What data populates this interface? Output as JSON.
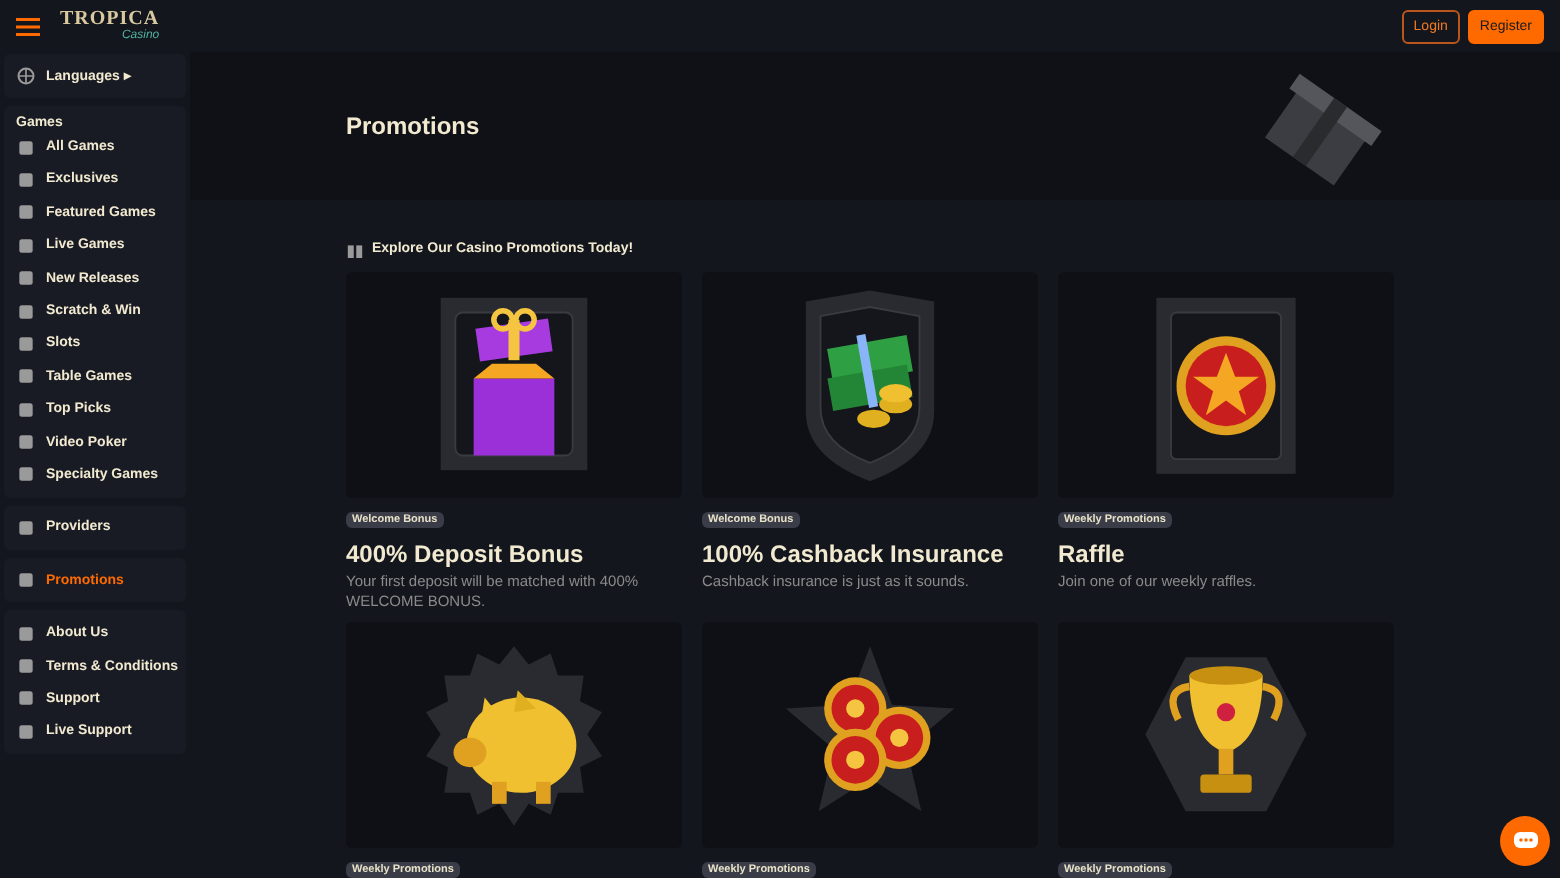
{
  "header": {
    "logo": {
      "name": "TROPICA",
      "tagline": "Casino"
    },
    "buttons": [
      {
        "label": "Login",
        "kind": "outline"
      },
      {
        "label": "Register",
        "kind": "filled"
      }
    ]
  },
  "sidebar": {
    "groups": [
      {
        "items": [
          {
            "label": "Languages ▸",
            "selected": false
          }
        ]
      },
      {
        "title": "Games",
        "items": [
          {
            "label": "All Games",
            "selected": false
          },
          {
            "label": "Exclusives",
            "selected": false
          },
          {
            "label": "Featured Games",
            "selected": false
          },
          {
            "label": "Live Games",
            "selected": false
          },
          {
            "label": "New Releases",
            "selected": false
          },
          {
            "label": "Scratch & Win",
            "selected": false
          },
          {
            "label": "Slots",
            "selected": false
          },
          {
            "label": "Table Games",
            "selected": false
          },
          {
            "label": "Top Picks",
            "selected": false
          },
          {
            "label": "Video Poker",
            "selected": false
          },
          {
            "label": "Specialty Games",
            "selected": false
          }
        ]
      },
      {
        "items": [
          {
            "label": "Providers",
            "selected": false
          }
        ]
      },
      {
        "items": [
          {
            "label": "Promotions",
            "selected": true
          }
        ]
      },
      {
        "items": [
          {
            "label": "About Us",
            "selected": false
          },
          {
            "label": "Terms & Conditions",
            "selected": false
          },
          {
            "label": "Support",
            "selected": false
          },
          {
            "label": "Live Support",
            "selected": false
          }
        ]
      }
    ]
  },
  "banner": {
    "title": "Promotions"
  },
  "section": {
    "heading": "Explore Our Casino Promotions Today!"
  },
  "promotions": [
    {
      "kind": "gift",
      "badge": "Welcome Bonus",
      "title": "400% Deposit Bonus",
      "description": "Your first deposit will be matched with 400% WELCOME BONUS."
    },
    {
      "kind": "cash",
      "badge": "Welcome Bonus",
      "title": "100% Cashback Insurance",
      "description": "Cashback insurance is just as it sounds."
    },
    {
      "kind": "medal",
      "badge": "Weekly Promotions",
      "title": "Raffle",
      "description": "Join one of our weekly raffles."
    },
    {
      "kind": "piggy",
      "badge": "Weekly Promotions"
    },
    {
      "kind": "coins",
      "badge": "Weekly Promotions"
    },
    {
      "kind": "trophy",
      "badge": "Weekly Promotions"
    }
  ]
}
